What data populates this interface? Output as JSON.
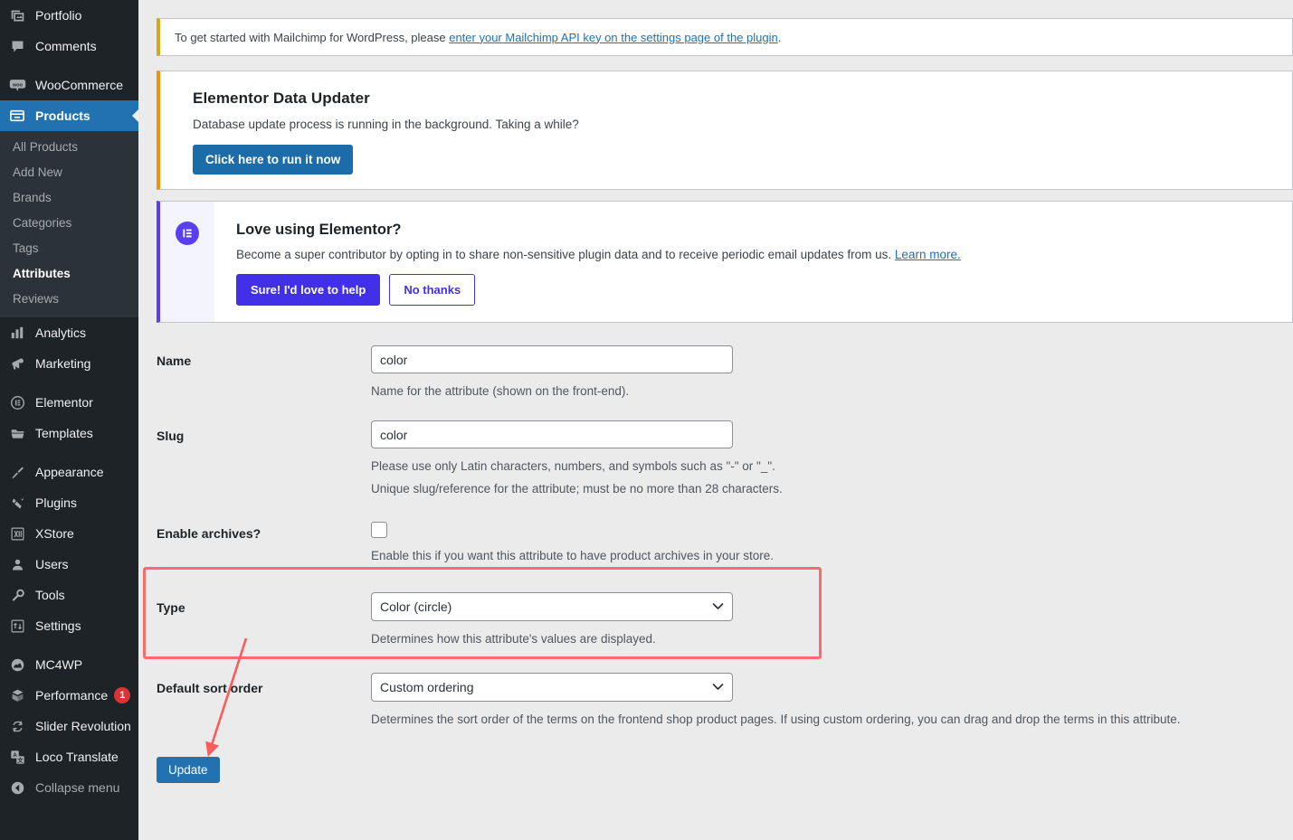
{
  "sidebar": {
    "items": [
      {
        "label": "Portfolio",
        "icon": "portfolio-icon",
        "state": "normal"
      },
      {
        "label": "Comments",
        "icon": "comments-icon",
        "state": "normal"
      },
      {
        "label": "WooCommerce",
        "icon": "woocommerce-icon",
        "state": "normal"
      },
      {
        "label": "Products",
        "icon": "products-icon",
        "state": "current"
      },
      {
        "label": "Analytics",
        "icon": "analytics-icon",
        "state": "normal"
      },
      {
        "label": "Marketing",
        "icon": "marketing-icon",
        "state": "normal"
      },
      {
        "label": "Elementor",
        "icon": "elementor-icon",
        "state": "normal"
      },
      {
        "label": "Templates",
        "icon": "templates-icon",
        "state": "normal"
      },
      {
        "label": "Appearance",
        "icon": "appearance-icon",
        "state": "normal"
      },
      {
        "label": "Plugins",
        "icon": "plugins-icon",
        "state": "normal"
      },
      {
        "label": "XStore",
        "icon": "xstore-icon",
        "state": "normal"
      },
      {
        "label": "Users",
        "icon": "users-icon",
        "state": "normal"
      },
      {
        "label": "Tools",
        "icon": "tools-icon",
        "state": "normal"
      },
      {
        "label": "Settings",
        "icon": "settings-icon",
        "state": "normal"
      },
      {
        "label": "MC4WP",
        "icon": "mc4wp-icon",
        "state": "normal"
      },
      {
        "label": "Performance",
        "icon": "performance-icon",
        "state": "normal",
        "badge": "1"
      },
      {
        "label": "Slider Revolution",
        "icon": "slider-revolution-icon",
        "state": "normal"
      },
      {
        "label": "Loco Translate",
        "icon": "loco-translate-icon",
        "state": "normal"
      },
      {
        "label": "Collapse menu",
        "icon": "collapse-menu-icon",
        "state": "dim"
      }
    ],
    "submenu": [
      {
        "label": "All Products",
        "active": false
      },
      {
        "label": "Add New",
        "active": false
      },
      {
        "label": "Brands",
        "active": false
      },
      {
        "label": "Categories",
        "active": false
      },
      {
        "label": "Tags",
        "active": false
      },
      {
        "label": "Attributes",
        "active": true
      },
      {
        "label": "Reviews",
        "active": false
      }
    ]
  },
  "notices": {
    "mailchimp": {
      "text_before": "To get started with Mailchimp for WordPress, please ",
      "link_text": "enter your Mailchimp API key on the settings page of the plugin",
      "text_after": ".",
      "accent_color": "#dba617"
    },
    "elementor_updater": {
      "title": "Elementor Data Updater",
      "body": "Database update process is running in the background. Taking a while?",
      "button_label": "Click here to run it now",
      "accent_color": "#f79009"
    },
    "elementor_love": {
      "title": "Love using Elementor?",
      "body": "Become a super contributor by opting in to share non-sensitive plugin data and to receive periodic email updates from us. ",
      "link_text": "Learn more.",
      "primary_button": "Sure! I'd love to help",
      "secondary_button": "No thanks",
      "accent_color": "#5a3ff0"
    }
  },
  "form": {
    "name": {
      "label": "Name",
      "value": "color",
      "help": "Name for the attribute (shown on the front-end)."
    },
    "slug": {
      "label": "Slug",
      "value": "color",
      "help1": "Please use only Latin characters, numbers, and symbols such as \"-\" or \"_\".",
      "help2": "Unique slug/reference for the attribute; must be no more than 28 characters."
    },
    "enable_archives": {
      "label": "Enable archives?",
      "checked": false,
      "help": "Enable this if you want this attribute to have product archives in your store."
    },
    "type": {
      "label": "Type",
      "value": "Color (circle)",
      "help": "Determines how this attribute's values are displayed."
    },
    "sort_order": {
      "label": "Default sort order",
      "value": "Custom ordering",
      "help": "Determines the sort order of the terms on the frontend shop product pages. If using custom ordering, you can drag and drop the terms in this attribute."
    },
    "submit_label": "Update"
  },
  "annotations": {
    "highlight_color": "#f96c6c",
    "arrow_color": "#fa5b5b"
  }
}
